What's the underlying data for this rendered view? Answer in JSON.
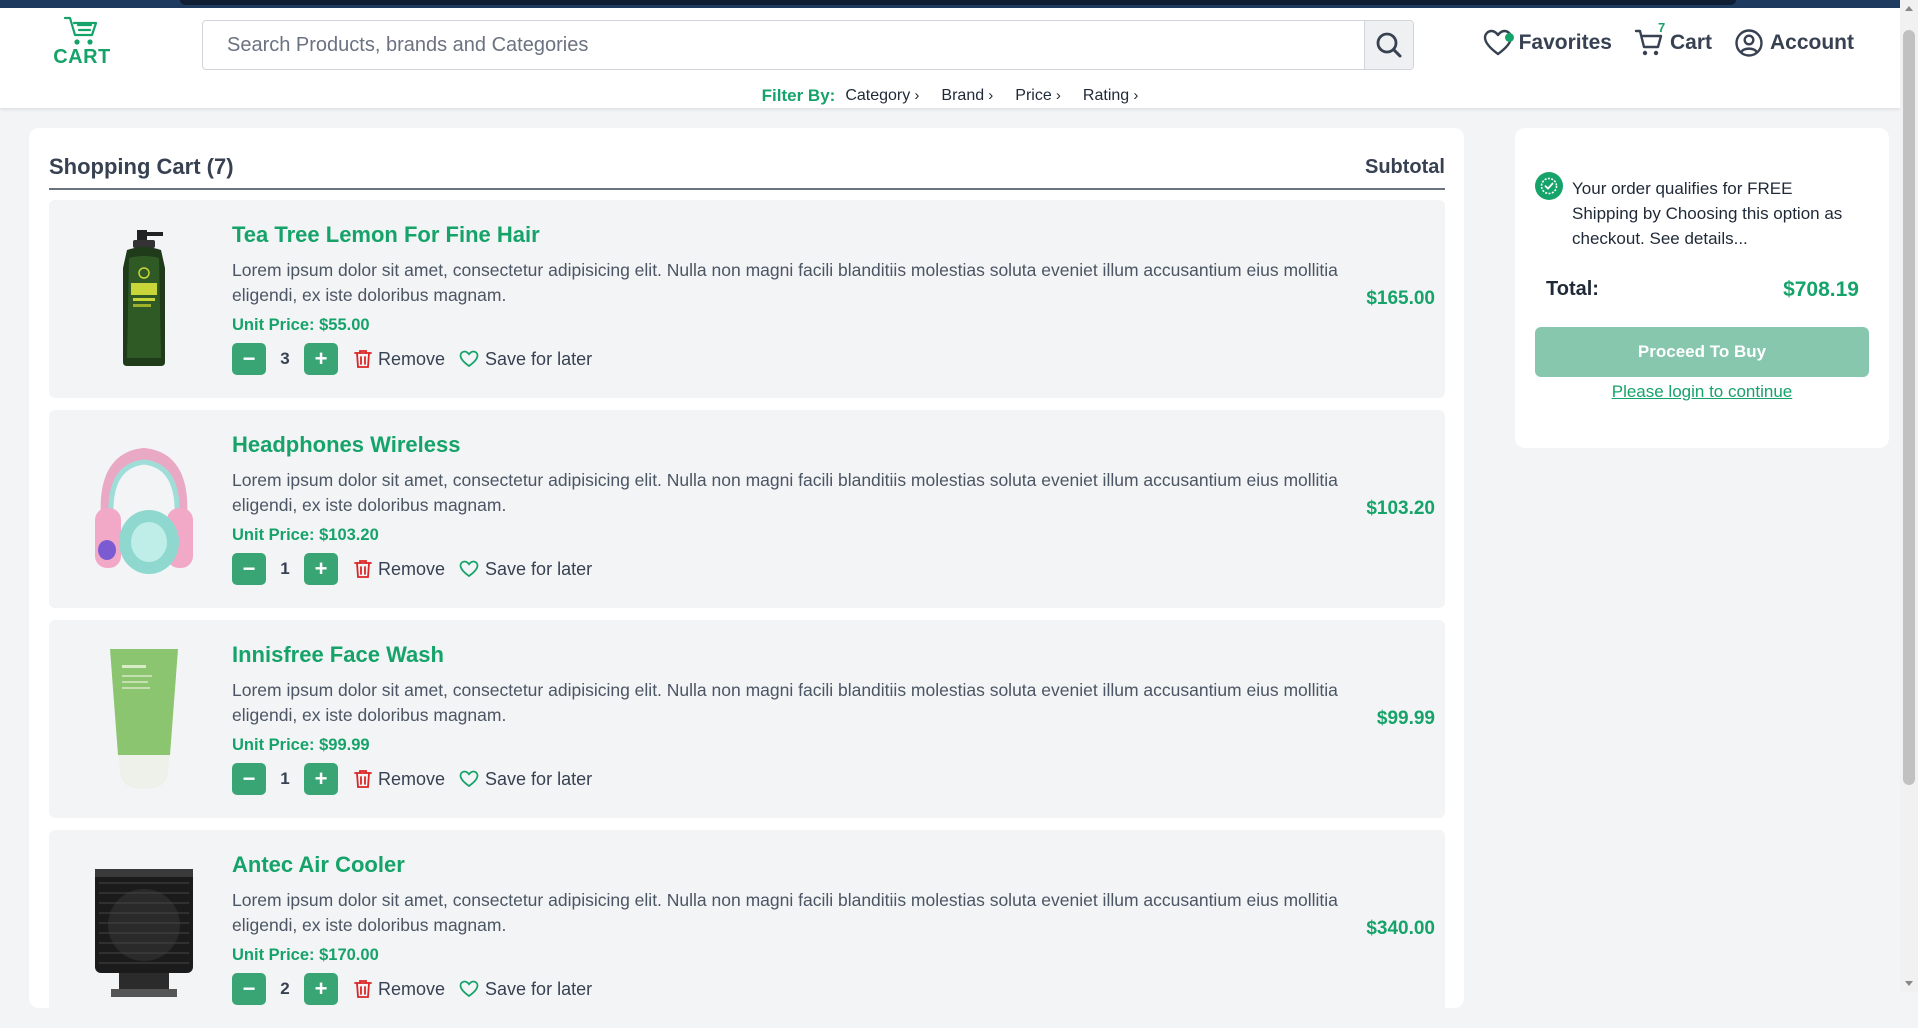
{
  "header": {
    "logo_text": "CART",
    "search_placeholder": "Search Products, brands and Categories",
    "nav": {
      "favorites": "Favorites",
      "cart": "Cart",
      "cart_count": "7",
      "account": "Account"
    }
  },
  "filters": {
    "label": "Filter By:",
    "items": [
      "Category",
      "Brand",
      "Price",
      "Rating"
    ]
  },
  "cart": {
    "title": "Shopping Cart (7)",
    "subtotal_header": "Subtotal",
    "remove_label": "Remove",
    "save_label": "Save for later",
    "items": [
      {
        "name": "Tea Tree Lemon For Fine Hair",
        "description": "Lorem ipsum dolor sit amet, consectetur adipisicing elit. Nulla non magni facili blanditiis molestias soluta eveniet illum accusantium eius mollitia eligendi, ex iste doloribus magnam.",
        "unit_price": "Unit Price: $55.00",
        "quantity": "3",
        "subtotal": "$165.00",
        "image": "shampoo-bottle"
      },
      {
        "name": "Headphones Wireless",
        "description": "Lorem ipsum dolor sit amet, consectetur adipisicing elit. Nulla non magni facili blanditiis molestias soluta eveniet illum accusantium eius mollitia eligendi, ex iste doloribus magnam.",
        "unit_price": "Unit Price: $103.20",
        "quantity": "1",
        "subtotal": "$103.20",
        "image": "headphones"
      },
      {
        "name": "Innisfree Face Wash",
        "description": "Lorem ipsum dolor sit amet, consectetur adipisicing elit. Nulla non magni facili blanditiis molestias soluta eveniet illum accusantium eius mollitia eligendi, ex iste doloribus magnam.",
        "unit_price": "Unit Price: $99.99",
        "quantity": "1",
        "subtotal": "$99.99",
        "image": "face-wash-tube"
      },
      {
        "name": "Antec Air Cooler",
        "description": "Lorem ipsum dolor sit amet, consectetur adipisicing elit. Nulla non magni facili blanditiis molestias soluta eveniet illum accusantium eius mollitia eligendi, ex iste doloribus magnam.",
        "unit_price": "Unit Price: $170.00",
        "quantity": "2",
        "subtotal": "$340.00",
        "image": "cpu-cooler"
      }
    ]
  },
  "summary": {
    "shipping_note": "Your order qualifies for FREE Shipping by Choosing this option as checkout. See details...",
    "total_label": "Total:",
    "total_value": "$708.19",
    "buy_button": "Proceed To Buy",
    "login_link": "Please login to continue"
  },
  "colors": {
    "accent": "#16a36a",
    "button": "#3aa574",
    "buy_button": "#86c7ad",
    "remove_icon": "#dc2626"
  }
}
